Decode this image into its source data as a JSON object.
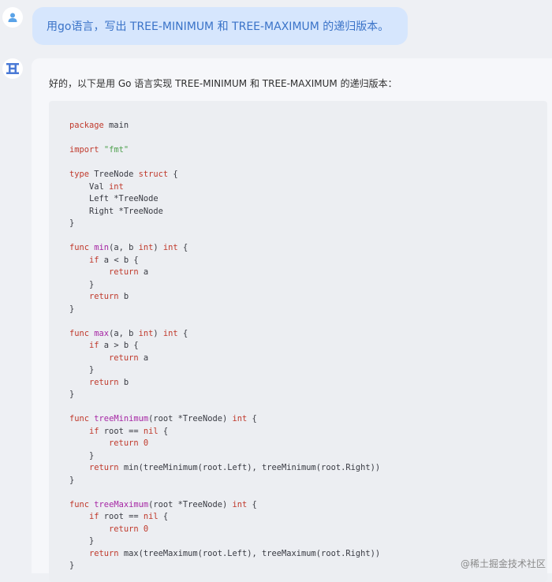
{
  "user_message": {
    "text": "用go语言，写出 TREE-MINIMUM 和 TREE-MAXIMUM 的递归版本。"
  },
  "bot_message": {
    "intro": "好的，以下是用 Go 语言实现 TREE-MINIMUM 和 TREE-MAXIMUM 的递归版本：",
    "code_lines": [
      [
        {
          "t": "package",
          "c": "kw"
        },
        {
          "t": " main"
        }
      ],
      [],
      [
        {
          "t": "import",
          "c": "kw"
        },
        {
          "t": " "
        },
        {
          "t": "\"fmt\"",
          "c": "str"
        }
      ],
      [],
      [
        {
          "t": "type",
          "c": "kw"
        },
        {
          "t": " TreeNode "
        },
        {
          "t": "struct",
          "c": "kw"
        },
        {
          "t": " {"
        }
      ],
      [
        {
          "t": "    Val "
        },
        {
          "t": "int",
          "c": "kw"
        }
      ],
      [
        {
          "t": "    Left *TreeNode"
        }
      ],
      [
        {
          "t": "    Right *TreeNode"
        }
      ],
      [
        {
          "t": "}"
        }
      ],
      [],
      [
        {
          "t": "func",
          "c": "kw"
        },
        {
          "t": " "
        },
        {
          "t": "min",
          "c": "fn"
        },
        {
          "t": "(a, b "
        },
        {
          "t": "int",
          "c": "kw"
        },
        {
          "t": ") "
        },
        {
          "t": "int",
          "c": "kw"
        },
        {
          "t": " {"
        }
      ],
      [
        {
          "t": "    "
        },
        {
          "t": "if",
          "c": "kw"
        },
        {
          "t": " a < b {"
        }
      ],
      [
        {
          "t": "        "
        },
        {
          "t": "return",
          "c": "kw"
        },
        {
          "t": " a"
        }
      ],
      [
        {
          "t": "    }"
        }
      ],
      [
        {
          "t": "    "
        },
        {
          "t": "return",
          "c": "kw"
        },
        {
          "t": " b"
        }
      ],
      [
        {
          "t": "}"
        }
      ],
      [],
      [
        {
          "t": "func",
          "c": "kw"
        },
        {
          "t": " "
        },
        {
          "t": "max",
          "c": "fn"
        },
        {
          "t": "(a, b "
        },
        {
          "t": "int",
          "c": "kw"
        },
        {
          "t": ") "
        },
        {
          "t": "int",
          "c": "kw"
        },
        {
          "t": " {"
        }
      ],
      [
        {
          "t": "    "
        },
        {
          "t": "if",
          "c": "kw"
        },
        {
          "t": " a > b {"
        }
      ],
      [
        {
          "t": "        "
        },
        {
          "t": "return",
          "c": "kw"
        },
        {
          "t": " a"
        }
      ],
      [
        {
          "t": "    }"
        }
      ],
      [
        {
          "t": "    "
        },
        {
          "t": "return",
          "c": "kw"
        },
        {
          "t": " b"
        }
      ],
      [
        {
          "t": "}"
        }
      ],
      [],
      [
        {
          "t": "func",
          "c": "kw"
        },
        {
          "t": " "
        },
        {
          "t": "treeMinimum",
          "c": "fn"
        },
        {
          "t": "(root *TreeNode) "
        },
        {
          "t": "int",
          "c": "kw"
        },
        {
          "t": " {"
        }
      ],
      [
        {
          "t": "    "
        },
        {
          "t": "if",
          "c": "kw"
        },
        {
          "t": " root == "
        },
        {
          "t": "nil",
          "c": "kw"
        },
        {
          "t": " {"
        }
      ],
      [
        {
          "t": "        "
        },
        {
          "t": "return",
          "c": "kw"
        },
        {
          "t": " "
        },
        {
          "t": "0",
          "c": "num"
        }
      ],
      [
        {
          "t": "    }"
        }
      ],
      [
        {
          "t": "    "
        },
        {
          "t": "return",
          "c": "kw"
        },
        {
          "t": " min(treeMinimum(root.Left), treeMinimum(root.Right))"
        }
      ],
      [
        {
          "t": "}"
        }
      ],
      [],
      [
        {
          "t": "func",
          "c": "kw"
        },
        {
          "t": " "
        },
        {
          "t": "treeMaximum",
          "c": "fn"
        },
        {
          "t": "(root *TreeNode) "
        },
        {
          "t": "int",
          "c": "kw"
        },
        {
          "t": " {"
        }
      ],
      [
        {
          "t": "    "
        },
        {
          "t": "if",
          "c": "kw"
        },
        {
          "t": " root == "
        },
        {
          "t": "nil",
          "c": "kw"
        },
        {
          "t": " {"
        }
      ],
      [
        {
          "t": "        "
        },
        {
          "t": "return",
          "c": "kw"
        },
        {
          "t": " "
        },
        {
          "t": "0",
          "c": "num"
        }
      ],
      [
        {
          "t": "    }"
        }
      ],
      [
        {
          "t": "    "
        },
        {
          "t": "return",
          "c": "kw"
        },
        {
          "t": " max(treeMaximum(root.Left), treeMaximum(root.Right))"
        }
      ],
      [
        {
          "t": "}"
        }
      ]
    ]
  },
  "icons": {
    "user_avatar": "user-icon",
    "bot_avatar": "bot-logo-icon"
  },
  "colors": {
    "user_bubble": "#d6e6fd",
    "user_text": "#3a73c8",
    "code_keyword": "#c0392b",
    "code_function": "#a626a4",
    "code_string": "#50a14f"
  },
  "footer": {
    "watermark": "@稀土掘金技术社区"
  }
}
